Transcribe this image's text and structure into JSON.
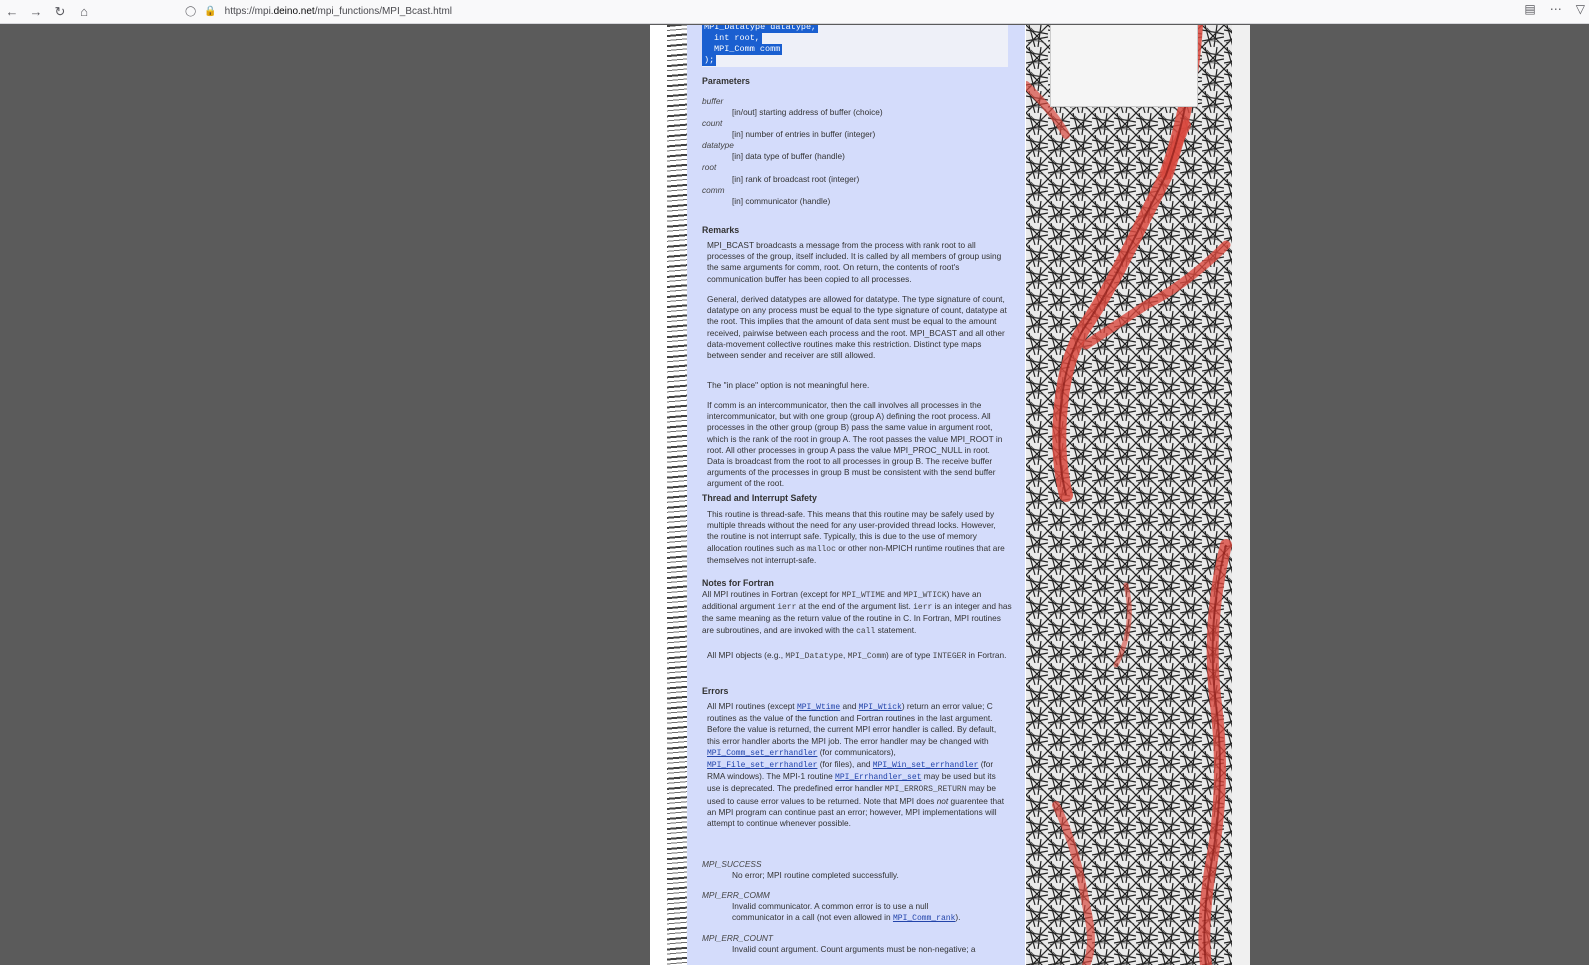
{
  "browser": {
    "url_prefix": "https://mpi.",
    "url_host": "deino.net",
    "url_path": "/mpi_functions/MPI_Bcast.html",
    "icons": [
      "back-icon",
      "forward-icon",
      "reload-icon",
      "home-icon",
      "shield-icon",
      "lock-icon",
      "reader-icon",
      "menu-icon",
      "pocket-icon"
    ]
  },
  "code": {
    "line1": "MPI_Datatype datatype,",
    "line2": "int root,",
    "line3": "MPI_Comm comm",
    "line4": ");"
  },
  "parameters": {
    "heading": "Parameters",
    "items": [
      {
        "name": "buffer",
        "desc": "[in/out] starting address of buffer (choice)"
      },
      {
        "name": "count",
        "desc": "[in] number of entries in buffer (integer)"
      },
      {
        "name": "datatype",
        "desc": "[in] data type of buffer (handle)"
      },
      {
        "name": "root",
        "desc": "[in] rank of broadcast root (integer)"
      },
      {
        "name": "comm",
        "desc": "[in] communicator (handle)"
      }
    ]
  },
  "remarks": {
    "heading": "Remarks",
    "p1": "MPI_BCAST broadcasts a message from the process with rank root to all processes of the group, itself included. It is called by all members of group using the same arguments for comm, root. On return, the contents of root's communication buffer has been copied to all processes.",
    "p2": "General, derived datatypes are allowed for datatype. The type signature of count, datatype on any process must be equal to the type signature of count, datatype at the root. This implies that the amount of data sent must be equal to the amount received, pairwise between each process and the root. MPI_BCAST and all other data-movement collective routines make this restriction. Distinct type maps between sender and receiver are still allowed.",
    "p3": "The \"in place\" option is not meaningful here.",
    "p4": "If comm is an intercommunicator, then the call involves all processes in the intercommunicator, but with one group (group A) defining the root process. All processes in the other group (group B) pass the same value in argument root, which is the rank of the root in group A. The root passes the value MPI_ROOT in root. All other processes in group A pass the value MPI_PROC_NULL in root. Data is broadcast from the root to all processes in group B. The receive buffer arguments of the processes in group B must be consistent with the send buffer argument of the root."
  },
  "thread": {
    "heading": "Thread and Interrupt Safety",
    "p1a": "This routine is thread-safe. This means that this routine may be safely used by multiple threads without the need for any user-provided thread locks. However, the routine is not interrupt safe. Typically, this is due to the use of memory allocation routines such as",
    "p1code": "malloc",
    "p1b": "or other non-MPICH runtime routines that are themselves not interrupt-safe."
  },
  "fortran": {
    "heading": "Notes for Fortran",
    "t1": "All MPI routines in Fortran (except for",
    "c1": "MPI_WTIME",
    "t2": "and",
    "c2": "MPI_WTICK",
    "t3": ") have an additional argument",
    "c3": "ierr",
    "t4": "at the end of the argument list.",
    "c4": "ierr",
    "t5": "is an integer and has the same meaning as the return value of the routine in C. In Fortran, MPI routines are subroutines, and are invoked with the",
    "c5": "call",
    "t6": "statement.",
    "p2a": "All MPI objects (e.g.,",
    "p2c1": "MPI_Datatype",
    "p2sep": ",",
    "p2c2": "MPI_Comm",
    "p2b": ") are of type",
    "p2c3": "INTEGER",
    "p2c": "in Fortran."
  },
  "errors": {
    "heading": "Errors",
    "a": "All MPI routines (except",
    "l1": "MPI_Wtime",
    "b": "and",
    "l2": "MPI_Wtick",
    "c": ") return an error value; C routines as the value of the function and Fortran routines in the last argument. Before the value is returned, the current MPI error handler is called. By default, this error handler aborts the MPI job. The error handler may be changed with",
    "l3": "MPI_Comm_set_errhandler",
    "d": "(for communicators),",
    "l4": "MPI_File_set_errhandler",
    "e": "(for files), and",
    "l5": "MPI_Win_set_errhandler",
    "f": "(for RMA windows). The MPI-1 routine",
    "l6": "MPI_Errhandler_set",
    "g": "may be used but its use is deprecated. The predefined error handler",
    "c6": "MPI_ERRORS_RETURN",
    "h": "may be used to cause error values to be returned. Note that MPI does",
    "em": "not",
    "i": "guarentee that an MPI program can continue past an error; however, MPI implementations will attempt to continue whenever possible.",
    "codes": [
      {
        "name": "MPI_SUCCESS",
        "desc": "No error; MPI routine completed successfully."
      },
      {
        "name": "MPI_ERR_COMM",
        "desc": "Invalid communicator. A common error is to use a null communicator in a call (not even allowed in",
        "link": "MPI_Comm_rank",
        "tail": ")."
      },
      {
        "name": "MPI_ERR_COUNT",
        "desc": "Invalid count argument. Count arguments must be non-negative; a"
      }
    ]
  }
}
